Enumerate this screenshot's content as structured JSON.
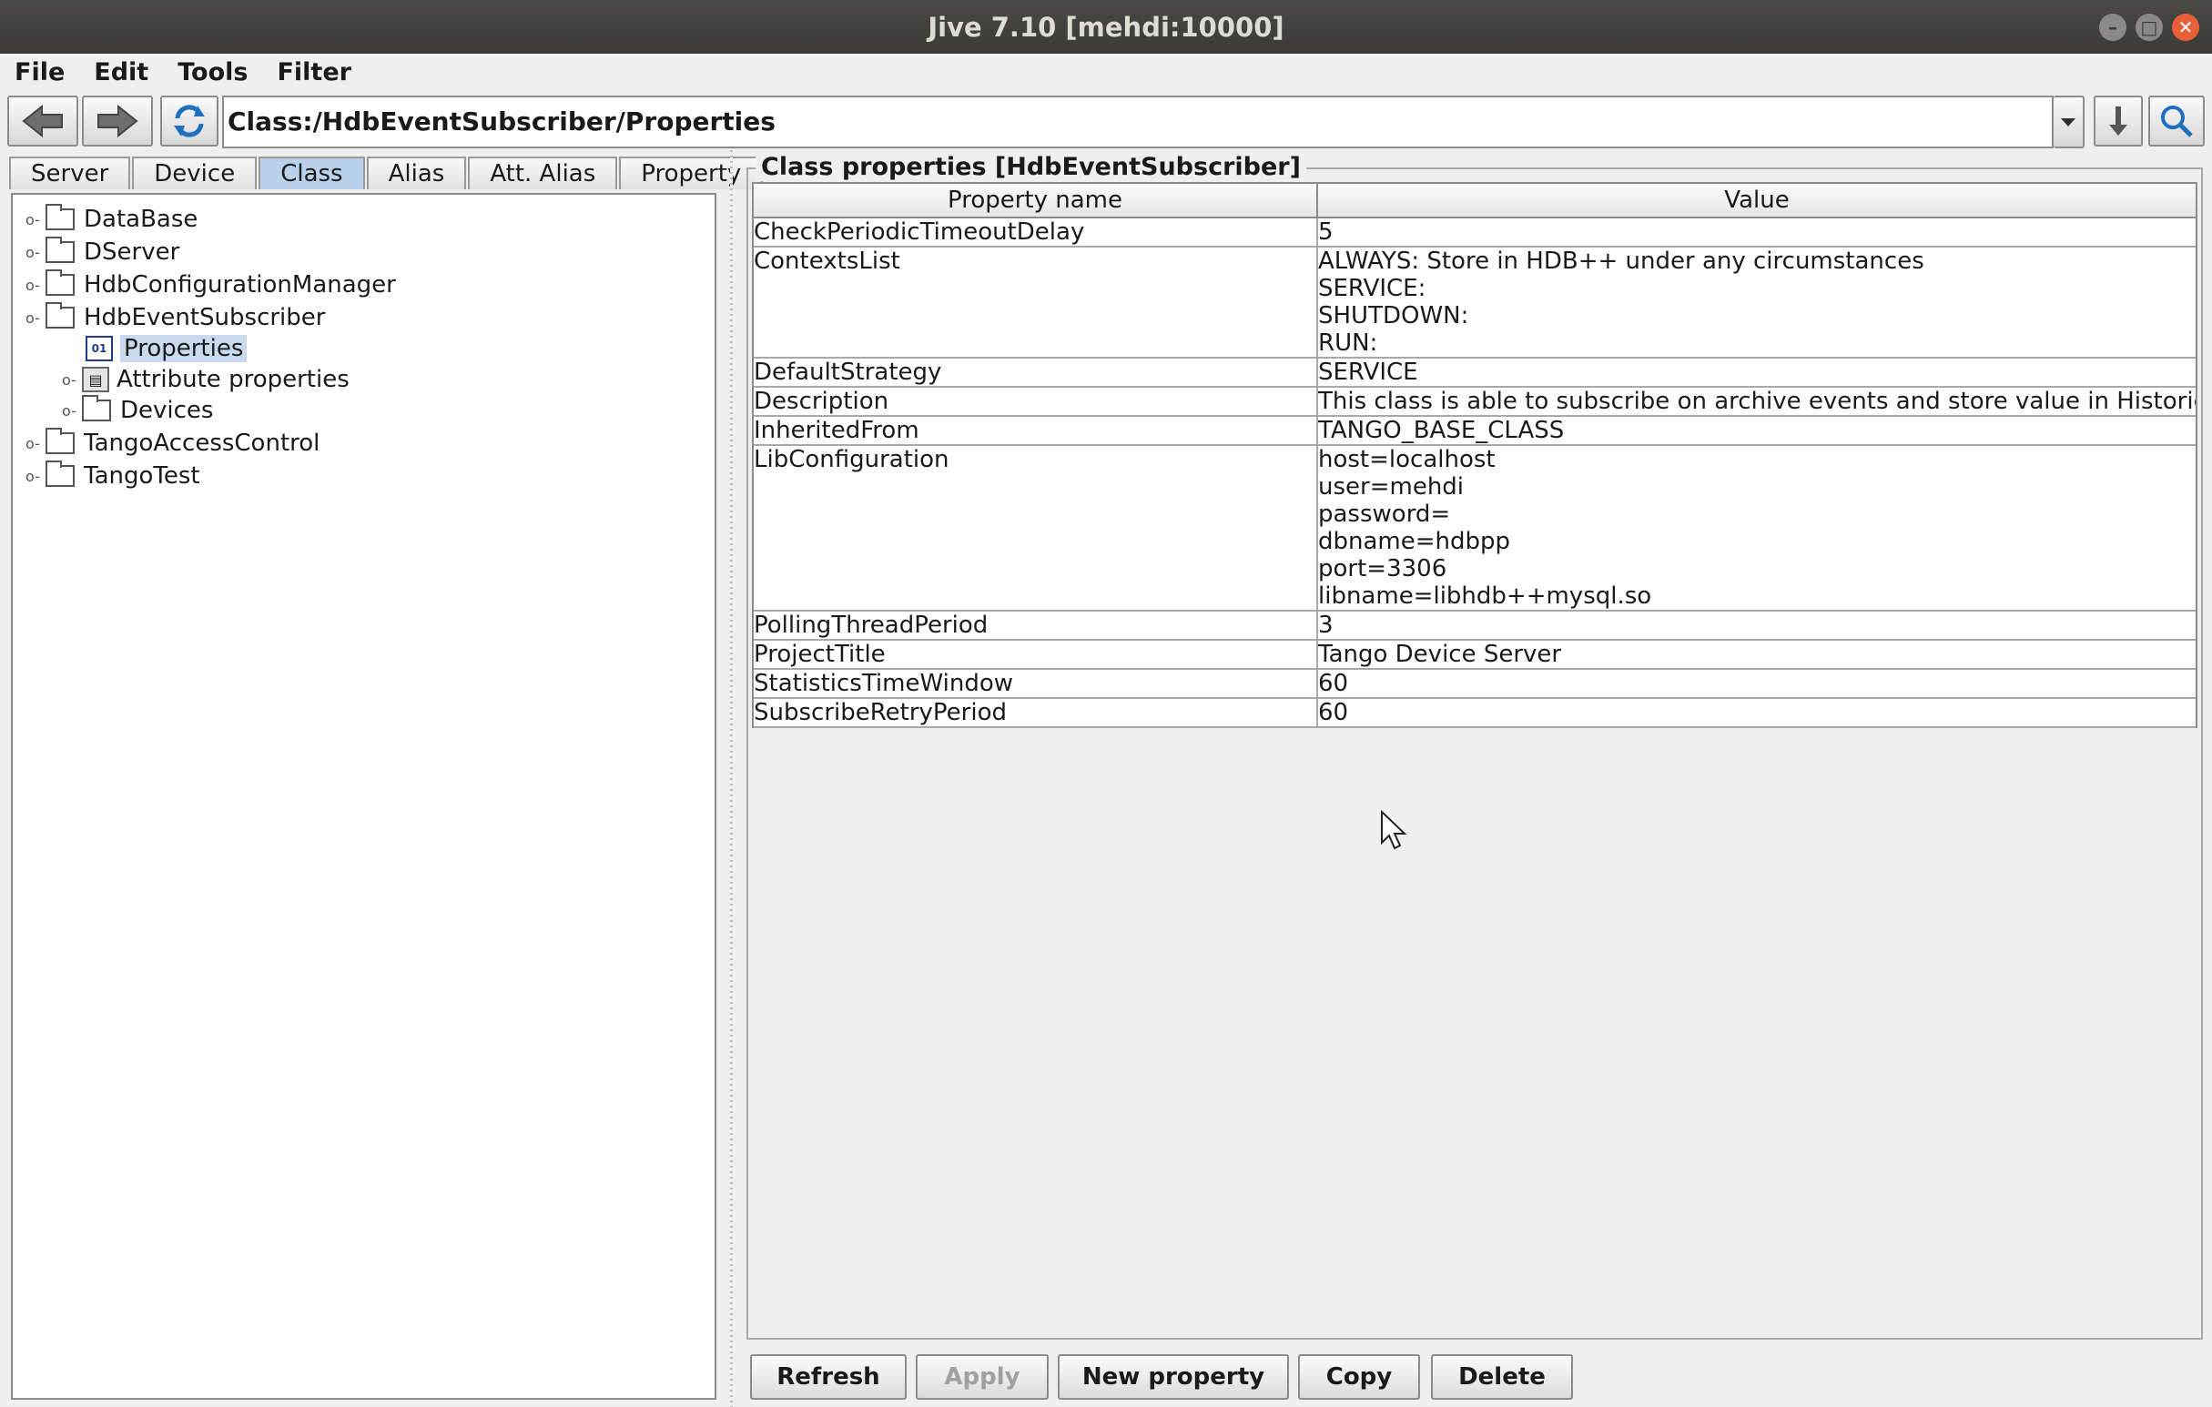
{
  "window": {
    "title": "Jive 7.10 [mehdi:10000]",
    "controls": [
      "minimize",
      "maximize",
      "close"
    ]
  },
  "menubar": {
    "items": [
      "File",
      "Edit",
      "Tools",
      "Filter"
    ]
  },
  "toolbar": {
    "path": "Class:/HdbEventSubscriber/Properties",
    "icons": [
      "back-arrow-icon",
      "forward-arrow-icon",
      "refresh-icon",
      "dropdown-icon",
      "download-icon",
      "search-icon"
    ]
  },
  "tabs": {
    "items": [
      "Server",
      "Device",
      "Class",
      "Alias",
      "Att. Alias",
      "Property"
    ],
    "active": "Class"
  },
  "tree": {
    "nodes": [
      {
        "label": "DataBase",
        "icon": "folder-icon"
      },
      {
        "label": "DServer",
        "icon": "folder-icon"
      },
      {
        "label": "HdbConfigurationManager",
        "icon": "folder-icon"
      },
      {
        "label": "HdbEventSubscriber",
        "icon": "folder-icon",
        "expanded": true
      },
      {
        "label": "Properties",
        "icon": "properties-icon",
        "selected": true
      },
      {
        "label": "Attribute properties",
        "icon": "attribute-properties-icon"
      },
      {
        "label": "Devices",
        "icon": "folder-icon"
      },
      {
        "label": "TangoAccessControl",
        "icon": "folder-icon"
      },
      {
        "label": "TangoTest",
        "icon": "folder-icon"
      }
    ]
  },
  "properties_panel": {
    "title": "Class properties [HdbEventSubscriber]",
    "columns": [
      "Property name",
      "Value"
    ],
    "rows": [
      {
        "name": "CheckPeriodicTimeoutDelay",
        "value": [
          "5"
        ]
      },
      {
        "name": "ContextsList",
        "value": [
          "ALWAYS: Store in HDB++ under any circumstances",
          "SERVICE:",
          "SHUTDOWN:",
          "RUN:"
        ]
      },
      {
        "name": "DefaultStrategy",
        "value": [
          "SERVICE"
        ]
      },
      {
        "name": "Description",
        "value": [
          "This class is able to subscribe on archive events and store value in Historical DB"
        ]
      },
      {
        "name": "InheritedFrom",
        "value": [
          "TANGO_BASE_CLASS"
        ]
      },
      {
        "name": "LibConfiguration",
        "value": [
          "host=localhost",
          "user=mehdi",
          "password=",
          "dbname=hdbpp",
          "port=3306",
          "libname=libhdb++mysql.so"
        ]
      },
      {
        "name": "PollingThreadPeriod",
        "value": [
          "3"
        ]
      },
      {
        "name": "ProjectTitle",
        "value": [
          "Tango Device Server"
        ]
      },
      {
        "name": "StatisticsTimeWindow",
        "value": [
          "60"
        ]
      },
      {
        "name": "SubscribeRetryPeriod",
        "value": [
          "60"
        ]
      }
    ]
  },
  "buttons": {
    "refresh": "Refresh",
    "apply": "Apply",
    "new_property": "New property",
    "copy": "Copy",
    "delete": "Delete"
  },
  "colors": {
    "titlebar": "#3b3a36",
    "close_button": "#e8603a",
    "selection": "#c9d9ee",
    "active_tab": "#b9d1ea",
    "refresh_icon": "#1f6fc1"
  }
}
